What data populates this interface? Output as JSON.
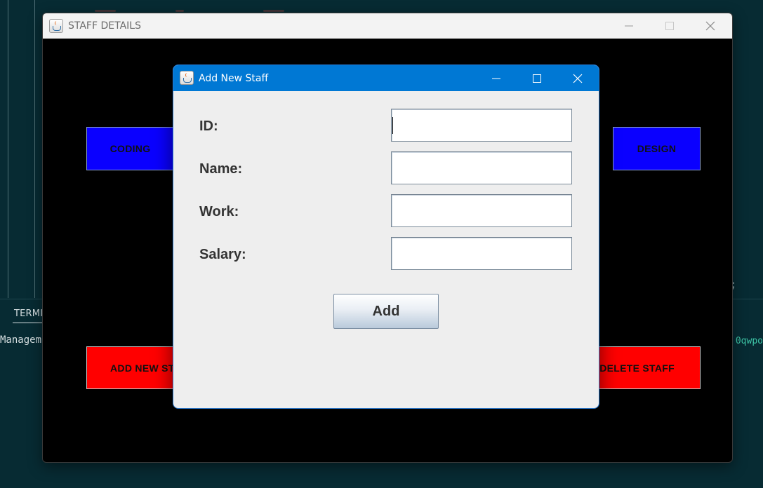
{
  "background": {
    "terminal_tab": "TERMI",
    "left_text": "Managem",
    "right_text": "0qwpo",
    "semicolon": ";"
  },
  "main_window": {
    "title": "STAFF DETAILS",
    "buttons": {
      "coding": "CODING",
      "design": "DESIGN",
      "add_new_staff": "ADD NEW ST",
      "delete_staff": "DELETE STAFF"
    },
    "colors": {
      "blue": "#0a00ff",
      "red": "#ff0000"
    }
  },
  "dialog": {
    "title": "Add New Staff",
    "fields": [
      {
        "label": "ID:",
        "value": ""
      },
      {
        "label": "Name:",
        "value": ""
      },
      {
        "label": "Work:",
        "value": ""
      },
      {
        "label": "Salary:",
        "value": ""
      }
    ],
    "add_label": "Add",
    "accent": "#0078d4"
  },
  "icons": [
    "java-app-icon",
    "minimize-icon",
    "maximize-icon",
    "close-icon"
  ]
}
